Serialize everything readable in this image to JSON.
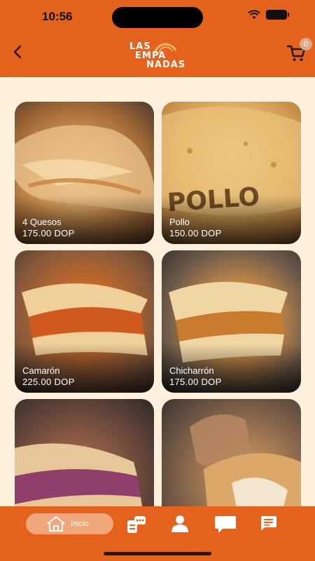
{
  "status_bar": {
    "time": "10:56"
  },
  "header": {
    "logo_lines": [
      "LAS",
      "EMPA",
      "NADAS"
    ],
    "cart_count": "0"
  },
  "products": [
    {
      "name": "4 Quesos",
      "price": "175.00 DOP"
    },
    {
      "name": "Pollo",
      "price": "150.00 DOP"
    },
    {
      "name": "Camarón",
      "price": "225.00 DOP"
    },
    {
      "name": "Chicharrón",
      "price": "175.00 DOP"
    },
    {
      "name": "",
      "price": ""
    },
    {
      "name": "",
      "price": ""
    }
  ],
  "tabbar": {
    "home_label": "Inicio",
    "icons": [
      "home-icon",
      "menu-board-icon",
      "user-icon",
      "chat-icon",
      "message-icon"
    ]
  },
  "colors": {
    "brand_orange": "#e4621b",
    "background": "#fdf0dd",
    "active_tab": "#f0a77c"
  }
}
